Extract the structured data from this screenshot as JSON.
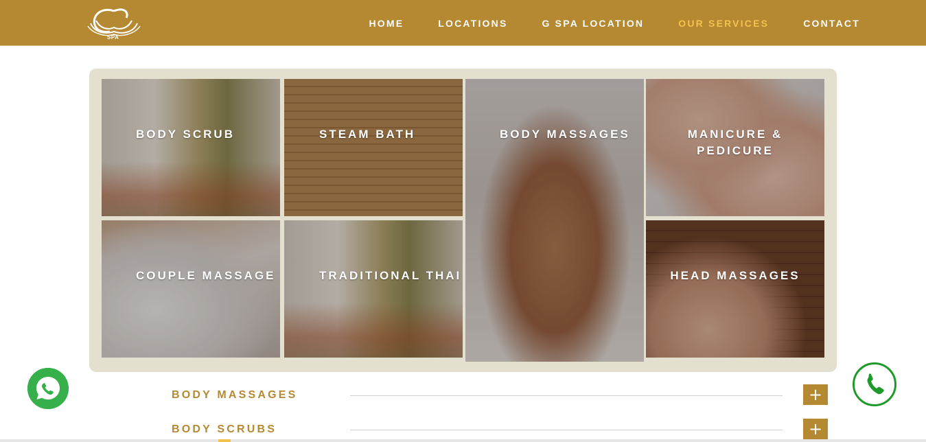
{
  "brand": {
    "logo_text": "SPA",
    "logo_icon": "lotus-g-logo"
  },
  "nav": [
    {
      "label": "HOME",
      "active": false
    },
    {
      "label": "LOCATIONS",
      "active": false
    },
    {
      "label": "G SPA LOCATION",
      "active": false
    },
    {
      "label": "OUR SERVICES",
      "active": true
    },
    {
      "label": "CONTACT",
      "active": false
    }
  ],
  "services": [
    {
      "label": "BODY SCRUB"
    },
    {
      "label": "STEAM BATH"
    },
    {
      "label": "BODY MASSAGES"
    },
    {
      "label_line1": "MANICURE &",
      "label_line2": "PEDICURE"
    },
    {
      "label": "COUPLE MASSAGE"
    },
    {
      "label": "TRADITIONAL THAI"
    },
    {
      "label": "HEAD MASSAGES"
    }
  ],
  "accordion": [
    {
      "title": "BODY MASSAGES",
      "toggle": "+"
    },
    {
      "title": "BODY SCRUBS",
      "toggle": "+"
    }
  ],
  "floating": {
    "whatsapp_icon": "whatsapp-icon",
    "call_icon": "phone-icon"
  },
  "colors": {
    "brand_gold": "#b58931",
    "nav_active": "#f2c34d",
    "panel_bg": "#e3e0cf",
    "whatsapp_green": "#36b04a",
    "call_green": "#1e9a2a"
  }
}
